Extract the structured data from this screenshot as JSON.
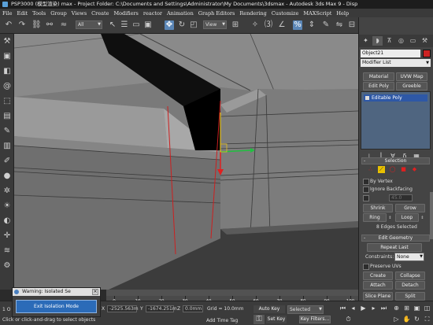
{
  "window": {
    "title": "PSP3000 (模型渲染) max - Project Folder: C:\\Documents and Settings\\Administrator\\My Documents\\3dsmax - Autodesk 3ds Max 9 - Disp"
  },
  "menu": [
    "File",
    "Edit",
    "Tools",
    "Group",
    "Views",
    "Create",
    "Modifiers",
    "reactor",
    "Animation",
    "Graph Editors",
    "Rendering",
    "Customize",
    "MAXScript",
    "Help"
  ],
  "toolbar": {
    "selection_filter": "All",
    "reference_coord": "View",
    "active_tool": "select-and-move"
  },
  "command_panel": {
    "object_name": "Object21",
    "object_color": "#cc2222",
    "modifier_list": "Modifier List",
    "buttons": [
      "Material",
      "UVW Map",
      "Edit Poly",
      "Greeble"
    ],
    "stack_item": "Editable Poly",
    "selection": {
      "header": "Selection",
      "by_vertex": "By Vertex",
      "ignore_backfacing": "Ignore Backfacing",
      "threshold": "45.0",
      "shrink": "Shrink",
      "grow": "Grow",
      "ring": "Ring",
      "loop": "Loop",
      "status": "8 Edges Selected"
    },
    "edit_geometry": {
      "header": "Edit Geometry",
      "repeat_last": "Repeat Last",
      "constraints_label": "Constraints:",
      "constraints_value": "None",
      "preserve_uvs": "Preserve UVs",
      "create": "Create",
      "collapse": "Collapse",
      "attach": "Attach",
      "detach": "Detach",
      "slice_plane": "Slice Plane",
      "split": "Split"
    }
  },
  "timeline": {
    "ticks": [
      "0",
      "10",
      "20",
      "30",
      "40",
      "50",
      "60",
      "70",
      "80",
      "90",
      "100"
    ]
  },
  "status": {
    "frame_left": "1 O",
    "x_value": "-2525.563m",
    "y_value": "-1674.251m",
    "z_value": "0.0mm",
    "grid": "Grid = 10.0mm",
    "auto_key": "Auto Key",
    "selected": "Selected",
    "set_key": "Set Key",
    "key_filters": "Key Filters...",
    "add_time_tag": "Add Time Tag",
    "prompt": "Click or click-and-drag to select objects"
  },
  "isolation_dialog": {
    "title": "Warning: Isolated Se",
    "button": "Exit Isolation Mode"
  }
}
